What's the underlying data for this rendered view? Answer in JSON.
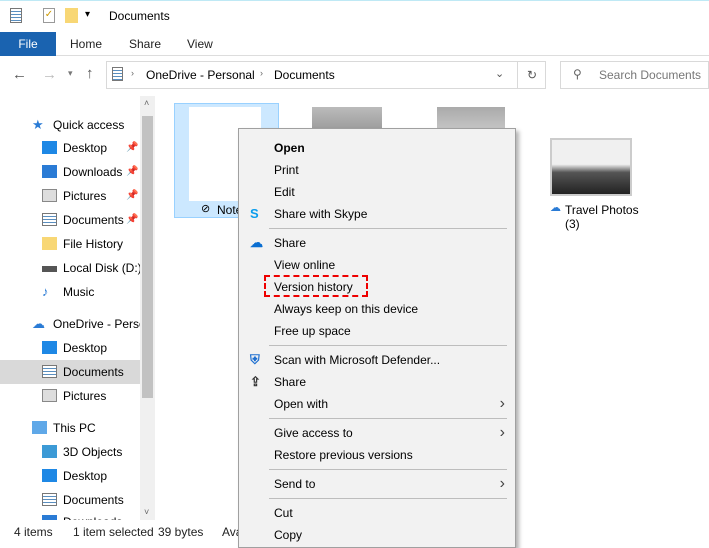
{
  "window": {
    "title": "Documents"
  },
  "ribbon": {
    "tabs": [
      "File",
      "Home",
      "Share",
      "View"
    ]
  },
  "address": {
    "segments": [
      "OneDrive - Personal",
      "Documents"
    ]
  },
  "search": {
    "placeholder": "Search Documents"
  },
  "nav": {
    "items": [
      {
        "label": "Quick access",
        "icon": "star-icon"
      },
      {
        "label": "Desktop",
        "icon": "desktop-icon",
        "pinned": true
      },
      {
        "label": "Downloads",
        "icon": "download-icon",
        "pinned": true
      },
      {
        "label": "Pictures",
        "icon": "pictures-icon",
        "pinned": true
      },
      {
        "label": "Documents",
        "icon": "documents-icon",
        "pinned": true
      },
      {
        "label": "File History",
        "icon": "folder-icon"
      },
      {
        "label": "Local Disk (D:)",
        "icon": "drive-icon"
      },
      {
        "label": "Music",
        "icon": "music-icon"
      },
      {
        "label": "OneDrive - Personal",
        "icon": "cloud-icon"
      },
      {
        "label": "Desktop",
        "icon": "desktop-icon"
      },
      {
        "label": "Documents",
        "icon": "documents-icon",
        "selected": true
      },
      {
        "label": "Pictures",
        "icon": "pictures-icon"
      },
      {
        "label": "This PC",
        "icon": "pc-icon"
      },
      {
        "label": "3D Objects",
        "icon": "cube-icon"
      },
      {
        "label": "Desktop",
        "icon": "desktop-icon"
      },
      {
        "label": "Documents",
        "icon": "documents-icon"
      },
      {
        "label": "Downloads",
        "icon": "download-icon"
      }
    ]
  },
  "files": [
    {
      "label": "Notes"
    },
    {
      "label": ""
    },
    {
      "label": ""
    },
    {
      "label": "Travel Photos",
      "sub": "(3)"
    }
  ],
  "context_menu": {
    "items": [
      "Open",
      "Print",
      "Edit",
      "Share with Skype",
      "Share",
      "View online",
      "Version history",
      "Always keep on this device",
      "Free up space",
      "Scan with Microsoft Defender...",
      "Share",
      "Open with",
      "Give access to",
      "Restore previous versions",
      "Send to",
      "Cut",
      "Copy"
    ]
  },
  "status": {
    "items": "4 items",
    "selected": "1 item selected",
    "size": "39 bytes",
    "avail": "Available"
  },
  "colors": {
    "accent": "#1a63b0",
    "highlight": "#e00000",
    "selection": "#cce8ff"
  }
}
